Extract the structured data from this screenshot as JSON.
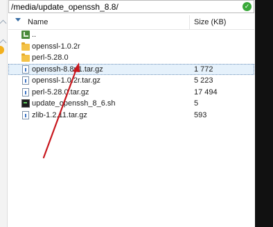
{
  "pathbar": {
    "path": "/media/update_openssh_8.8/",
    "ok_glyph": "✓"
  },
  "header": {
    "name_label": "Name",
    "size_label": "Size (KB)"
  },
  "files": [
    {
      "name": "..",
      "size": "",
      "type": "parent"
    },
    {
      "name": "openssl-1.0.2r",
      "size": "",
      "type": "folder"
    },
    {
      "name": "perl-5.28.0",
      "size": "",
      "type": "folder"
    },
    {
      "name": "openssh-8.8p1.tar.gz",
      "size": "1 772",
      "type": "file",
      "selected": true
    },
    {
      "name": "openssl-1.0.2r.tar.gz",
      "size": "5 223",
      "type": "file"
    },
    {
      "name": "perl-5.28.0.tar.gz",
      "size": "17 494",
      "type": "file"
    },
    {
      "name": "update_openssh_8_6.sh",
      "size": "5",
      "type": "script"
    },
    {
      "name": "zlib-1.2.11.tar.gz",
      "size": "593",
      "type": "file"
    }
  ],
  "colors": {
    "arrow": "#c8161d",
    "selection": "#e5f1fb",
    "ok": "#3aa93a"
  }
}
